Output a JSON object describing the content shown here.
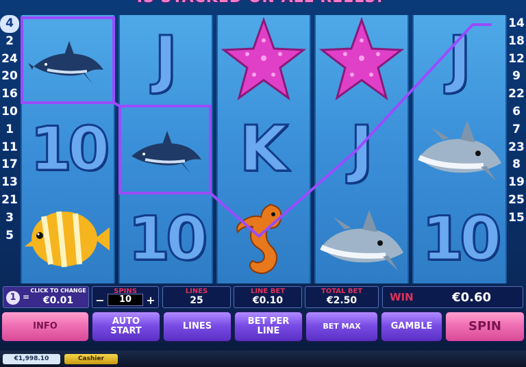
{
  "banner": {
    "text": "IS STACKED ON ALL REELS!"
  },
  "left_lines": [
    "4",
    "2",
    "24",
    "20",
    "16",
    "10",
    "1",
    "11",
    "17",
    "13",
    "21",
    "3",
    "5"
  ],
  "right_lines": [
    "14",
    "18",
    "12",
    "9",
    "22",
    "6",
    "7",
    "23",
    "8",
    "19",
    "25",
    "15"
  ],
  "highlighted_line": "4",
  "reels": [
    [
      "dolphin",
      "10",
      "tropical-fish"
    ],
    [
      "J",
      "dolphin",
      "10"
    ],
    [
      "starfish",
      "K",
      "seahorse"
    ],
    [
      "starfish",
      "J",
      "shark"
    ],
    [
      "J",
      "shark",
      "10"
    ]
  ],
  "info": {
    "coin_badge": "1",
    "coin_equals": "=",
    "coin_caption": "CLICK TO CHANGE",
    "coin_value": "€0.01",
    "spins_caption": "SPINS",
    "spins_value": "10",
    "spins_minus": "−",
    "spins_plus": "+",
    "lines_caption": "LINES",
    "lines_value": "25",
    "line_bet_caption": "LINE BET",
    "line_bet_value": "€0.10",
    "total_bet_caption": "TOTAL BET",
    "total_bet_value": "€2.50",
    "win_caption": "WIN",
    "win_value": "€0.60"
  },
  "buttons": {
    "info": "INFO",
    "auto_start": "AUTO\nSTART",
    "lines": "LINES",
    "bet_per_line": "BET PER\nLINE",
    "bet_max": "BET MAX",
    "gamble": "GAMBLE",
    "spin": "SPIN"
  },
  "footer": {
    "balance": "€1,998.10",
    "cashier": "Cashier"
  },
  "colors": {
    "starfish": "#e040c8",
    "seahorse": "#e8781c",
    "winline": "#9a4cff"
  }
}
